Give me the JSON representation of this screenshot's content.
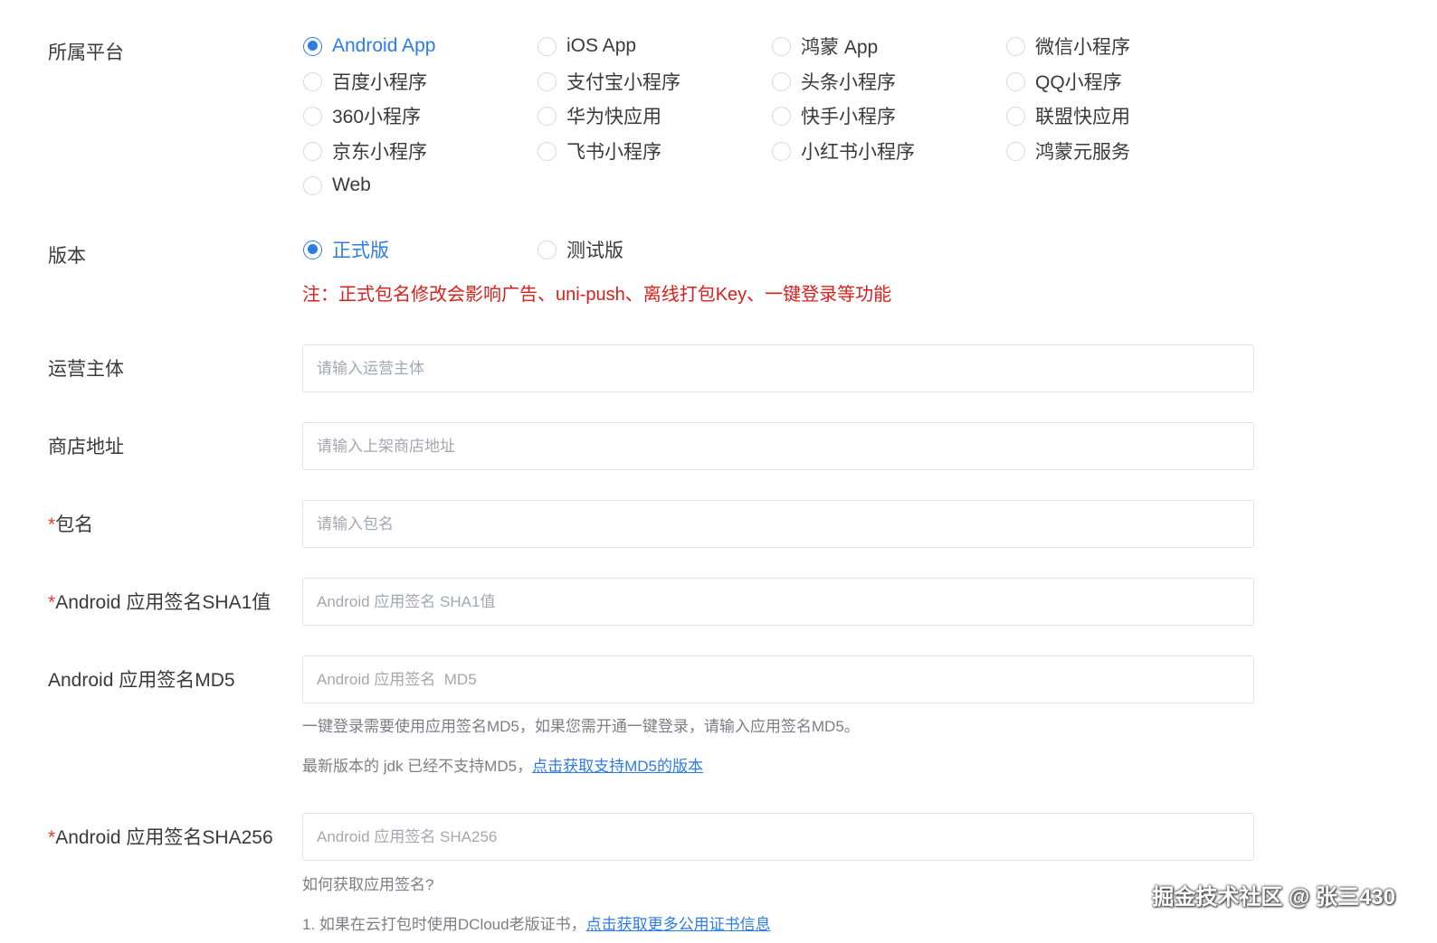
{
  "platform": {
    "label": "所属平台",
    "options": [
      {
        "label": "Android App",
        "checked": true
      },
      {
        "label": "iOS App",
        "checked": false
      },
      {
        "label": "鸿蒙 App",
        "checked": false
      },
      {
        "label": "微信小程序",
        "checked": false
      },
      {
        "label": "百度小程序",
        "checked": false
      },
      {
        "label": "支付宝小程序",
        "checked": false
      },
      {
        "label": "头条小程序",
        "checked": false
      },
      {
        "label": "QQ小程序",
        "checked": false
      },
      {
        "label": "360小程序",
        "checked": false
      },
      {
        "label": "华为快应用",
        "checked": false
      },
      {
        "label": "快手小程序",
        "checked": false
      },
      {
        "label": "联盟快应用",
        "checked": false
      },
      {
        "label": "京东小程序",
        "checked": false
      },
      {
        "label": "飞书小程序",
        "checked": false
      },
      {
        "label": "小红书小程序",
        "checked": false
      },
      {
        "label": "鸿蒙元服务",
        "checked": false
      },
      {
        "label": "Web",
        "checked": false
      }
    ]
  },
  "version": {
    "label": "版本",
    "options": [
      {
        "label": "正式版",
        "checked": true
      },
      {
        "label": "测试版",
        "checked": false
      }
    ],
    "note": "注：正式包名修改会影响广告、uni-push、离线打包Key、一键登录等功能"
  },
  "operator": {
    "label": "运营主体",
    "placeholder": "请输入运营主体"
  },
  "store_url": {
    "label": "商店地址",
    "placeholder": "请输入上架商店地址"
  },
  "package_name": {
    "required_mark": "*",
    "label": "包名",
    "placeholder": "请输入包名"
  },
  "sha1": {
    "required_mark": "*",
    "label": "Android 应用签名SHA1值",
    "placeholder": "Android 应用签名 SHA1值"
  },
  "md5": {
    "label": "Android 应用签名MD5",
    "placeholder": "Android 应用签名  MD5",
    "hint1": "一键登录需要使用应用签名MD5，如果您需开通一键登录，请输入应用签名MD5。",
    "hint2_text": "最新版本的 jdk 已经不支持MD5，",
    "hint2_link": "点击获取支持MD5的版本"
  },
  "sha256": {
    "required_mark": "*",
    "label": "Android 应用签名SHA256",
    "placeholder": "Android 应用签名 SHA256",
    "hint1": "如何获取应用签名?",
    "hint2_text": "1. 如果在云打包时使用DCloud老版证书，",
    "hint2_link": "点击获取更多公用证书信息"
  },
  "watermark": "掘金技术社区 @ 张三430"
}
